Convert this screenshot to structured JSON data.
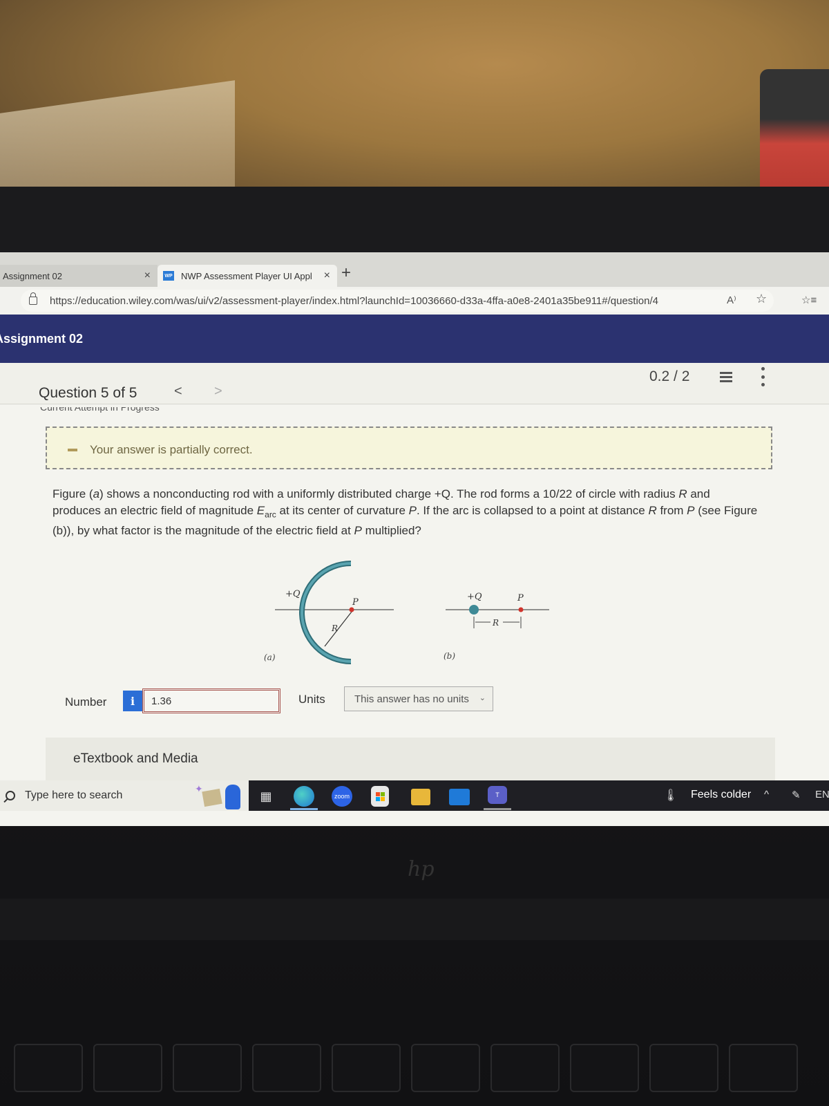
{
  "browser": {
    "tabs": [
      {
        "label": "Assignment 02",
        "active": false
      },
      {
        "label": "NWP Assessment Player UI Appl",
        "favicon": "WP",
        "active": true
      }
    ],
    "new_tab_icon": "+",
    "close_icon": "×",
    "url": "https://education.wiley.com/was/ui/v2/assessment-player/index.html?launchId=10036660-d33a-4ffa-a0e8-2401a35be911#/question/4",
    "read_aloud_icon": "A⁾",
    "add_favorite_icon": "☆",
    "favorites_icon": "☆≡"
  },
  "app": {
    "title": "Assignment 02",
    "header_color": "#2b3270"
  },
  "question_bar": {
    "label": "Question 5 of 5",
    "prev_icon": "<",
    "next_icon": ">",
    "score": "0.2 / 2",
    "attempt_label": "Current Attempt in Progress"
  },
  "feedback": {
    "message": "Your answer is partially correct.",
    "status": "partial"
  },
  "question": {
    "line1_pre": "Figure (",
    "line1_a": "a",
    "line1_post": ") shows a nonconducting rod with a uniformly distributed charge +Q. The rod forms a 10/22 of circle with radius ",
    "R": "R",
    "and": " and",
    "line2_pre": "produces an electric field of magnitude ",
    "E": "E",
    "E_sub": "arc",
    "line2_mid": " at its center of curvature ",
    "P": "P",
    "line2_post": ". If the arc is collapsed to a point at distance ",
    "line2_from": " from ",
    "line2_end": " (see Figure",
    "line3_pre": "(b)), by what factor is the magnitude of the electric field at ",
    "line3_post": " multiplied?"
  },
  "figure": {
    "a": {
      "charge_label": "+Q",
      "point_label": "P",
      "radius_label": "R",
      "caption": "(a)"
    },
    "b": {
      "charge_label": "+Q",
      "point_label": "P",
      "distance_label": "R",
      "caption": "(b)"
    },
    "rod_color": "#3f8a96",
    "point_color": "#d0342c"
  },
  "answer": {
    "number_label": "Number",
    "info_icon": "i",
    "number_value": "1.36",
    "units_label": "Units",
    "units_selected": "This answer has no units"
  },
  "etextbook": {
    "label": "eTextbook and Media"
  },
  "taskbar": {
    "search_placeholder": "Type here to search",
    "apps": [
      "task-view",
      "edge",
      "zoom",
      "microsoft-store",
      "file-explorer",
      "mail",
      "teams"
    ],
    "zoom_label": "zoom",
    "weather": "Feels colder",
    "tray_chevron": "^",
    "language": "EN"
  },
  "laptop": {
    "brand": "hp"
  }
}
